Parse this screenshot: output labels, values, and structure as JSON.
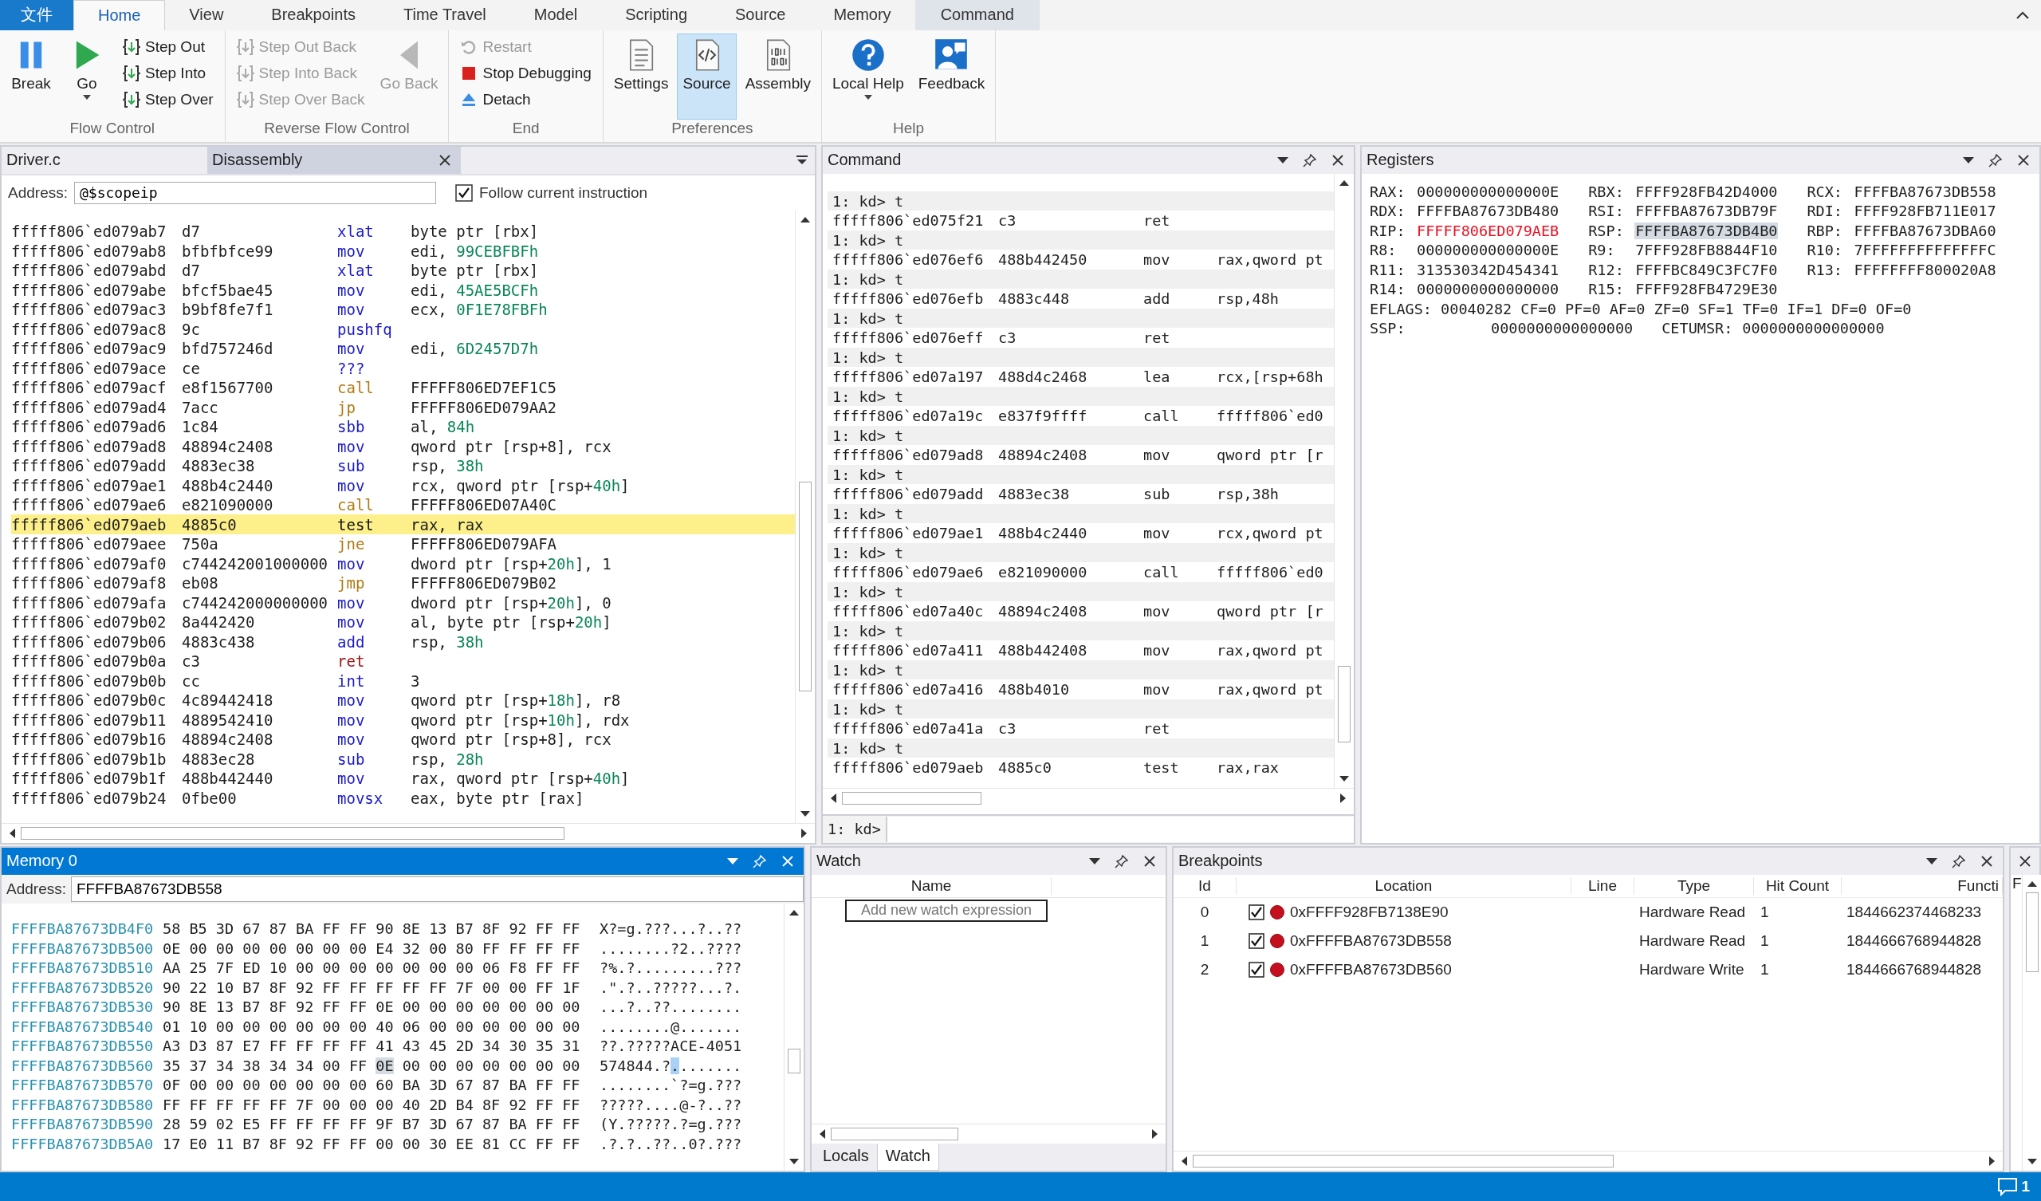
{
  "ribbon": {
    "tabs": [
      {
        "label": "文件",
        "kind": "file",
        "selected": false
      },
      {
        "label": "Home",
        "kind": "normal",
        "selected": true
      },
      {
        "label": "View",
        "kind": "normal",
        "selected": false
      },
      {
        "label": "Breakpoints",
        "kind": "normal",
        "selected": false
      },
      {
        "label": "Time Travel",
        "kind": "normal",
        "selected": false
      },
      {
        "label": "Model",
        "kind": "normal",
        "selected": false
      },
      {
        "label": "Scripting",
        "kind": "normal",
        "selected": false
      },
      {
        "label": "Source",
        "kind": "normal",
        "selected": false
      },
      {
        "label": "Memory",
        "kind": "normal",
        "selected": false
      },
      {
        "label": "Command",
        "kind": "contextual",
        "selected": false
      }
    ],
    "groups": [
      {
        "label": "Flow Control",
        "buttons": [
          {
            "label": "Break",
            "kind": "large",
            "disabled": false,
            "dropdown": false
          },
          {
            "label": "Go",
            "kind": "large",
            "disabled": false,
            "dropdown": true
          },
          {
            "label": "Step Out",
            "kind": "small",
            "disabled": false
          },
          {
            "label": "Step Into",
            "kind": "small",
            "disabled": false
          },
          {
            "label": "Step Over",
            "kind": "small",
            "disabled": false
          }
        ]
      },
      {
        "label": "Reverse Flow Control",
        "buttons": [
          {
            "label": "Step Out Back",
            "kind": "small",
            "disabled": true
          },
          {
            "label": "Step Into Back",
            "kind": "small",
            "disabled": true
          },
          {
            "label": "Step Over Back",
            "kind": "small",
            "disabled": true
          },
          {
            "label": "Go Back",
            "kind": "large",
            "disabled": true,
            "dropdown": false
          }
        ]
      },
      {
        "label": "End",
        "buttons": [
          {
            "label": "Restart",
            "kind": "small",
            "disabled": true
          },
          {
            "label": "Stop Debugging",
            "kind": "small",
            "disabled": false
          },
          {
            "label": "Detach",
            "kind": "small",
            "disabled": false
          }
        ]
      },
      {
        "label": "Preferences",
        "buttons": [
          {
            "label": "Settings",
            "kind": "large",
            "disabled": false,
            "dropdown": false,
            "selected": false
          },
          {
            "label": "Source",
            "kind": "large",
            "disabled": false,
            "dropdown": false,
            "selected": true
          },
          {
            "label": "Assembly",
            "kind": "large",
            "disabled": false,
            "dropdown": false,
            "selected": false
          }
        ]
      },
      {
        "label": "Help",
        "buttons": [
          {
            "label": "Local Help",
            "kind": "large",
            "disabled": false,
            "dropdown": true
          },
          {
            "label": "Feedback",
            "kind": "large",
            "disabled": false,
            "dropdown": false
          }
        ]
      }
    ]
  },
  "disassembly": {
    "tabs": [
      {
        "label": "Driver.c",
        "selected": false
      },
      {
        "label": "Disassembly",
        "selected": true
      }
    ],
    "address_label": "Address:",
    "address": "@$scopeip",
    "follow": {
      "label": "Follow current instruction",
      "checked": true
    },
    "rows": [
      {
        "addr": "fffff806`ed079ab7",
        "bytes": "d7",
        "op": "xlat",
        "kind": "normal",
        "operand": [
          "byte ptr [rbx]"
        ],
        "current": false
      },
      {
        "addr": "fffff806`ed079ab8",
        "bytes": "bfbfbfce99",
        "op": "mov",
        "kind": "normal",
        "operand": [
          "edi, ",
          "99CEBFBFh"
        ],
        "current": false
      },
      {
        "addr": "fffff806`ed079abd",
        "bytes": "d7",
        "op": "xlat",
        "kind": "normal",
        "operand": [
          "byte ptr [rbx]"
        ],
        "current": false
      },
      {
        "addr": "fffff806`ed079abe",
        "bytes": "bfcf5bae45",
        "op": "mov",
        "kind": "normal",
        "operand": [
          "edi, ",
          "45AE5BCFh"
        ],
        "current": false
      },
      {
        "addr": "fffff806`ed079ac3",
        "bytes": "b9bf8fe7f1",
        "op": "mov",
        "kind": "normal",
        "operand": [
          "ecx, ",
          "0F1E78FBFh"
        ],
        "current": false
      },
      {
        "addr": "fffff806`ed079ac8",
        "bytes": "9c",
        "op": "pushfq",
        "kind": "normal",
        "current": false
      },
      {
        "addr": "fffff806`ed079ac9",
        "bytes": "bfd757246d",
        "op": "mov",
        "kind": "normal",
        "operand": [
          "edi, ",
          "6D2457D7h"
        ],
        "current": false
      },
      {
        "addr": "fffff806`ed079ace",
        "bytes": "ce",
        "op": "???",
        "kind": "normal",
        "current": false
      },
      {
        "addr": "fffff806`ed079acf",
        "bytes": "e8f1567700",
        "op": "call",
        "kind": "branch",
        "operand": [
          "FFFFF806ED7EF1C5"
        ],
        "current": false
      },
      {
        "addr": "fffff806`ed079ad4",
        "bytes": "7acc",
        "op": "jp",
        "kind": "branch",
        "operand": [
          "FFFFF806ED079AA2"
        ],
        "current": false
      },
      {
        "addr": "fffff806`ed079ad6",
        "bytes": "1c84",
        "op": "sbb",
        "kind": "normal",
        "operand": [
          "al, ",
          "84h"
        ],
        "current": false
      },
      {
        "addr": "fffff806`ed079ad8",
        "bytes": "48894c2408",
        "op": "mov",
        "kind": "normal",
        "operand": [
          "qword ptr [rsp+8], rcx"
        ],
        "current": false
      },
      {
        "addr": "fffff806`ed079add",
        "bytes": "4883ec38",
        "op": "sub",
        "kind": "normal",
        "operand": [
          "rsp, ",
          "38h"
        ],
        "current": false
      },
      {
        "addr": "fffff806`ed079ae1",
        "bytes": "488b4c2440",
        "op": "mov",
        "kind": "normal",
        "operand": [
          "rcx, qword ptr [rsp+",
          "40h",
          "]"
        ],
        "current": false
      },
      {
        "addr": "fffff806`ed079ae6",
        "bytes": "e821090000",
        "op": "call",
        "kind": "branch",
        "operand": [
          "FFFFF806ED07A40C"
        ],
        "current": false
      },
      {
        "addr": "fffff806`ed079aeb",
        "bytes": "4885c0",
        "op": "test",
        "kind": "normal",
        "operand": [
          "rax, rax"
        ],
        "current": true
      },
      {
        "addr": "fffff806`ed079aee",
        "bytes": "750a",
        "op": "jne",
        "kind": "branch",
        "operand": [
          "FFFFF806ED079AFA"
        ],
        "current": false
      },
      {
        "addr": "fffff806`ed079af0",
        "bytes": "c744242001000000",
        "op": "mov",
        "kind": "normal",
        "operand": [
          "dword ptr [rsp+",
          "20h",
          "], 1"
        ],
        "current": false
      },
      {
        "addr": "fffff806`ed079af8",
        "bytes": "eb08",
        "op": "jmp",
        "kind": "branch",
        "operand": [
          "FFFFF806ED079B02"
        ],
        "current": false
      },
      {
        "addr": "fffff806`ed079afa",
        "bytes": "c744242000000000",
        "op": "mov",
        "kind": "normal",
        "operand": [
          "dword ptr [rsp+",
          "20h",
          "], 0"
        ],
        "current": false
      },
      {
        "addr": "fffff806`ed079b02",
        "bytes": "8a442420",
        "op": "mov",
        "kind": "normal",
        "operand": [
          "al, byte ptr [rsp+",
          "20h",
          "]"
        ],
        "current": false
      },
      {
        "addr": "fffff806`ed079b06",
        "bytes": "4883c438",
        "op": "add",
        "kind": "normal",
        "operand": [
          "rsp, ",
          "38h"
        ],
        "current": false
      },
      {
        "addr": "fffff806`ed079b0a",
        "bytes": "c3",
        "op": "ret",
        "kind": "return",
        "current": false
      },
      {
        "addr": "fffff806`ed079b0b",
        "bytes": "cc",
        "op": "int",
        "kind": "normal",
        "operand": [
          "3"
        ],
        "current": false
      },
      {
        "addr": "fffff806`ed079b0c",
        "bytes": "4c89442418",
        "op": "mov",
        "kind": "normal",
        "operand": [
          "qword ptr [rsp+",
          "18h",
          "], r8"
        ],
        "current": false
      },
      {
        "addr": "fffff806`ed079b11",
        "bytes": "4889542410",
        "op": "mov",
        "kind": "normal",
        "operand": [
          "qword ptr [rsp+",
          "10h",
          "], rdx"
        ],
        "current": false
      },
      {
        "addr": "fffff806`ed079b16",
        "bytes": "48894c2408",
        "op": "mov",
        "kind": "normal",
        "operand": [
          "qword ptr [rsp+8], rcx"
        ],
        "current": false
      },
      {
        "addr": "fffff806`ed079b1b",
        "bytes": "4883ec28",
        "op": "sub",
        "kind": "normal",
        "operand": [
          "rsp, ",
          "28h"
        ],
        "current": false
      },
      {
        "addr": "fffff806`ed079b1f",
        "bytes": "488b442440",
        "op": "mov",
        "kind": "normal",
        "operand": [
          "rax, qword ptr [rsp+",
          "40h",
          "]"
        ],
        "current": false
      },
      {
        "addr": "fffff806`ed079b24",
        "bytes": "0fbe00",
        "op": "movsx",
        "kind": "normal",
        "operand": [
          "eax, byte ptr [rax]"
        ],
        "current": false
      }
    ]
  },
  "command": {
    "title": "Command",
    "prompt": "1: kd>",
    "lines": [
      {
        "kind": "prompt",
        "text": "1: kd> t"
      },
      {
        "kind": "output",
        "addr": "fffff806`ed075f21",
        "bytes": "c3",
        "op": "ret"
      },
      {
        "kind": "prompt",
        "text": "1: kd> t"
      },
      {
        "kind": "output",
        "addr": "fffff806`ed076ef6",
        "bytes": "488b442450",
        "op": "mov",
        "operand": "rax,qword pt"
      },
      {
        "kind": "prompt",
        "text": "1: kd> t"
      },
      {
        "kind": "output",
        "addr": "fffff806`ed076efb",
        "bytes": "4883c448",
        "op": "add",
        "operand": "rsp,48h"
      },
      {
        "kind": "prompt",
        "text": "1: kd> t"
      },
      {
        "kind": "output",
        "addr": "fffff806`ed076eff",
        "bytes": "c3",
        "op": "ret"
      },
      {
        "kind": "prompt",
        "text": "1: kd> t"
      },
      {
        "kind": "output",
        "addr": "fffff806`ed07a197",
        "bytes": "488d4c2468",
        "op": "lea",
        "operand": "rcx,[rsp+68h"
      },
      {
        "kind": "prompt",
        "text": "1: kd> t"
      },
      {
        "kind": "output",
        "addr": "fffff806`ed07a19c",
        "bytes": "e837f9ffff",
        "op": "call",
        "operand": "fffff806`ed0"
      },
      {
        "kind": "prompt",
        "text": "1: kd> t"
      },
      {
        "kind": "output",
        "addr": "fffff806`ed079ad8",
        "bytes": "48894c2408",
        "op": "mov",
        "operand": "qword ptr [r"
      },
      {
        "kind": "prompt",
        "text": "1: kd> t"
      },
      {
        "kind": "output",
        "addr": "fffff806`ed079add",
        "bytes": "4883ec38",
        "op": "sub",
        "operand": "rsp,38h"
      },
      {
        "kind": "prompt",
        "text": "1: kd> t"
      },
      {
        "kind": "output",
        "addr": "fffff806`ed079ae1",
        "bytes": "488b4c2440",
        "op": "mov",
        "operand": "rcx,qword pt"
      },
      {
        "kind": "prompt",
        "text": "1: kd> t"
      },
      {
        "kind": "output",
        "addr": "fffff806`ed079ae6",
        "bytes": "e821090000",
        "op": "call",
        "operand": "fffff806`ed0"
      },
      {
        "kind": "prompt",
        "text": "1: kd> t"
      },
      {
        "kind": "output",
        "addr": "fffff806`ed07a40c",
        "bytes": "48894c2408",
        "op": "mov",
        "operand": "qword ptr [r"
      },
      {
        "kind": "prompt",
        "text": "1: kd> t"
      },
      {
        "kind": "output",
        "addr": "fffff806`ed07a411",
        "bytes": "488b442408",
        "op": "mov",
        "operand": "rax,qword pt"
      },
      {
        "kind": "prompt",
        "text": "1: kd> t"
      },
      {
        "kind": "output",
        "addr": "fffff806`ed07a416",
        "bytes": "488b4010",
        "op": "mov",
        "operand": "rax,qword pt"
      },
      {
        "kind": "prompt",
        "text": "1: kd> t"
      },
      {
        "kind": "output",
        "addr": "fffff806`ed07a41a",
        "bytes": "c3",
        "op": "ret"
      },
      {
        "kind": "prompt",
        "text": "1: kd> t"
      },
      {
        "kind": "output",
        "addr": "fffff806`ed079aeb",
        "bytes": "4885c0",
        "op": "test",
        "operand": "rax,rax"
      }
    ]
  },
  "registers": {
    "title": "Registers",
    "items": [
      {
        "name": "RAX:",
        "value": "000000000000000E",
        "changed": false,
        "selected": false
      },
      {
        "name": "RBX:",
        "value": "FFFF928FB42D4000",
        "changed": false,
        "selected": false
      },
      {
        "name": "RCX:",
        "value": "FFFFBA87673DB558",
        "changed": false,
        "selected": false
      },
      {
        "name": "RDX:",
        "value": "FFFFBA87673DB480",
        "changed": false,
        "selected": false
      },
      {
        "name": "RSI:",
        "value": "FFFFBA87673DB79F",
        "changed": false,
        "selected": false
      },
      {
        "name": "RDI:",
        "value": "FFFF928FB711E017",
        "changed": false,
        "selected": false
      },
      {
        "name": "RIP:",
        "value": "FFFFF806ED079AEB",
        "changed": true,
        "selected": false
      },
      {
        "name": "RSP:",
        "value": "FFFFBA87673DB4B0",
        "changed": false,
        "selected": true
      },
      {
        "name": "RBP:",
        "value": "FFFFBA87673DBA60",
        "changed": false,
        "selected": false
      },
      {
        "name": "R8:",
        "value": "000000000000000E",
        "changed": false,
        "selected": false
      },
      {
        "name": "R9:",
        "value": "7FFF928FB8844F10",
        "changed": false,
        "selected": false
      },
      {
        "name": "R10:",
        "value": "7FFFFFFFFFFFFFFC",
        "changed": false,
        "selected": false
      },
      {
        "name": "R11:",
        "value": "313530342D454341",
        "changed": false,
        "selected": false
      },
      {
        "name": "R12:",
        "value": "FFFFBC849C3FC7F0",
        "changed": false,
        "selected": false
      },
      {
        "name": "R13:",
        "value": "FFFFFFFF800020A8",
        "changed": false,
        "selected": false
      },
      {
        "name": "R14:",
        "value": "0000000000000000",
        "changed": false,
        "selected": false
      },
      {
        "name": "R15:",
        "value": "FFFF928FB4729E30",
        "changed": false,
        "selected": false
      }
    ],
    "eflags": "EFLAGS: 00040282 CF=0 PF=0 AF=0 ZF=0 SF=1 TF=0 IF=1 DF=0 OF=0",
    "extra": [
      {
        "name": "SSP:",
        "value": "0000000000000000"
      },
      {
        "name": "CETUMSR:",
        "value": "0000000000000000"
      }
    ]
  },
  "memory": {
    "title": "Memory 0",
    "address_label": "Address:",
    "address": "FFFFBA87673DB558",
    "rows": [
      {
        "addr": "FFFFBA87673DB4F0",
        "hex": "58 B5 3D 67 87 BA FF FF 90 8E 13 B7 8F 92 FF FF",
        "ascii": "X?=g.???...?..??",
        "kind": "plain"
      },
      {
        "addr": "FFFFBA87673DB500",
        "hex": "0E 00 00 00 00 00 00 00 E4 32 00 80 FF FF FF FF",
        "ascii": "........?2..????",
        "kind": "plain"
      },
      {
        "addr": "FFFFBA87673DB510",
        "hex": "AA 25 7F ED 10 00 00 00 00 00 00 00 06 F8 FF FF",
        "ascii": "?%.?.........???",
        "kind": "plain"
      },
      {
        "addr": "FFFFBA87673DB520",
        "hex": "90 22 10 B7 8F 92 FF FF FF FF FF 7F 00 00 FF 1F",
        "ascii": ".\".?..?????...?.",
        "kind": "plain"
      },
      {
        "addr": "FFFFBA87673DB530",
        "hex": "90 8E 13 B7 8F 92 FF FF 0E 00 00 00 00 00 00 00",
        "ascii": "...?..??........",
        "kind": "plain"
      },
      {
        "addr": "FFFFBA87673DB540",
        "hex": "01 10 00 00 00 00 00 00 40 06 00 00 00 00 00 00",
        "ascii": "........@.......",
        "kind": "plain"
      },
      {
        "addr": "FFFFBA87673DB550",
        "hex": "A3 D3 87 E7 FF FF FF FF 41 43 45 2D 34 30 35 31",
        "ascii": "??.?????ACE-4051",
        "kind": "plain"
      },
      {
        "addr": "FFFFBA87673DB560",
        "hex_before": "35 37 34 38 34 34 00 FF",
        "hex_cursor": "0E",
        "hex_after": "00 00 00 00 00 00 00",
        "ascii_before": "574844.?",
        "ascii_cursor": ".",
        "ascii_after": ".......",
        "kind": "cursor"
      },
      {
        "addr": "FFFFBA87673DB570",
        "hex": "0F 00 00 00 00 00 00 00 60 BA 3D 67 87 BA FF FF",
        "ascii": "........`?=g.???",
        "kind": "plain"
      },
      {
        "addr": "FFFFBA87673DB580",
        "hex": "FF FF FF FF FF 7F 00 00 00 40 2D B4 8F 92 FF FF",
        "ascii": "?????....@-?..??",
        "kind": "plain"
      },
      {
        "addr": "FFFFBA87673DB590",
        "hex": "28 59 02 E5 FF FF FF FF 9F B7 3D 67 87 BA FF FF",
        "ascii": "(Y.?????.?=g.???",
        "kind": "plain"
      },
      {
        "addr": "FFFFBA87673DB5A0",
        "hex": "17 E0 11 B7 8F 92 FF FF 00 00 30 EE 81 CC FF FF",
        "ascii": ".?.?..??..0?.???",
        "kind": "plain"
      }
    ]
  },
  "watch": {
    "title": "Watch",
    "column": "Name",
    "placeholder": "Add new watch expression",
    "tabs": [
      {
        "label": "Locals",
        "selected": false
      },
      {
        "label": "Watch",
        "selected": true
      }
    ]
  },
  "breakpoints": {
    "title": "Breakpoints",
    "columns": [
      "Id",
      "Location",
      "Line",
      "Type",
      "Hit Count",
      "Functi"
    ],
    "rows": [
      {
        "id": "0",
        "enabled": true,
        "location": "0xFFFF928FB7138E90",
        "type": "Hardware Read",
        "hit_count": "1",
        "function": "1844662374468233"
      },
      {
        "id": "1",
        "enabled": true,
        "location": "0xFFFFBA87673DB558",
        "type": "Hardware Read",
        "hit_count": "1",
        "function": "1844666768944828"
      },
      {
        "id": "2",
        "enabled": true,
        "location": "0xFFFFBA87673DB560",
        "type": "Hardware Write",
        "hit_count": "1",
        "function": "1844666768944828"
      }
    ]
  },
  "side_pane": {
    "column_1": "F"
  },
  "status_bar": {
    "notifications": "1"
  }
}
